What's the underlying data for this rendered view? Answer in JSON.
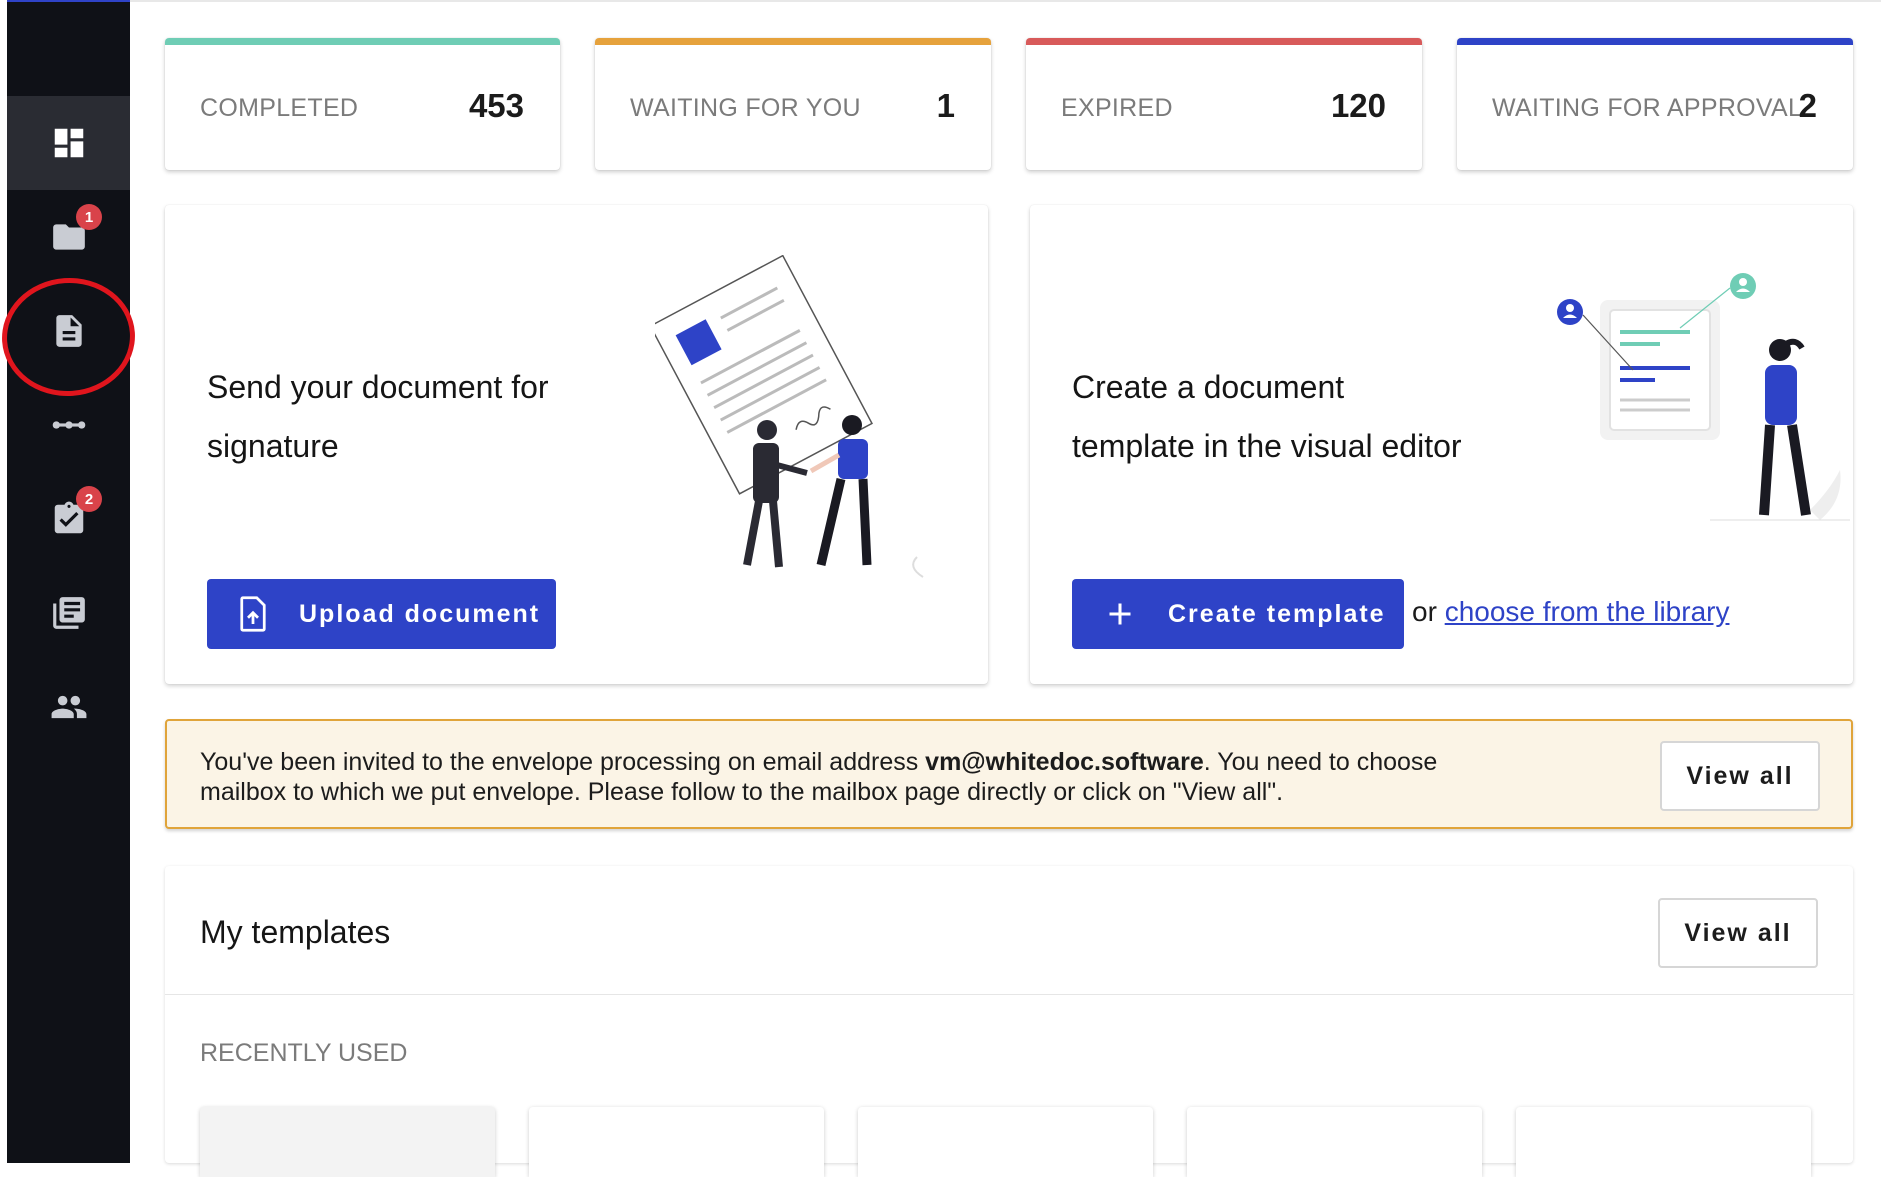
{
  "colors": {
    "sidebar_bg": "#0f1117",
    "accent": "#2e43c7",
    "completed": "#6fcdb5",
    "waiting_for_you": "#e6a23c",
    "expired": "#d85a5a",
    "waiting_for_approval": "#2e43c7",
    "badge": "#d9434a",
    "notice_bg": "#fbf4e6",
    "notice_border": "#e0a43a"
  },
  "sidebar": {
    "items": [
      {
        "icon": "dashboard-icon",
        "active": true
      },
      {
        "icon": "folder-icon",
        "badge": "1"
      },
      {
        "icon": "document-icon"
      },
      {
        "icon": "workflow-icon"
      },
      {
        "icon": "clipboard-check-icon",
        "badge": "2"
      },
      {
        "icon": "library-icon"
      },
      {
        "icon": "people-icon"
      }
    ]
  },
  "stats": [
    {
      "label": "COMPLETED",
      "value": "453"
    },
    {
      "label": "WAITING FOR YOU",
      "value": "1"
    },
    {
      "label": "EXPIRED",
      "value": "120"
    },
    {
      "label": "WAITING FOR APPROVAL",
      "value": "2"
    }
  ],
  "send_card": {
    "heading_line1": "Send your document for",
    "heading_line2": "signature",
    "button_label": "Upload document"
  },
  "template_card": {
    "heading_line1": "Create a document",
    "heading_line2": "template in the visual editor",
    "button_label": "Create template",
    "or_text": "or",
    "library_link": "choose from the library"
  },
  "notice": {
    "text_before": "You've been invited to the envelope processing on email address ",
    "email": "vm@whitedoc.software",
    "text_after": ". You need to choose mailbox to which we put envelope. Please follow to the mailbox page directly or click on \"View all\".",
    "button_label": "View all"
  },
  "templates": {
    "title": "My templates",
    "view_all_label": "View all",
    "recently_used_label": "RECENTLY USED"
  }
}
